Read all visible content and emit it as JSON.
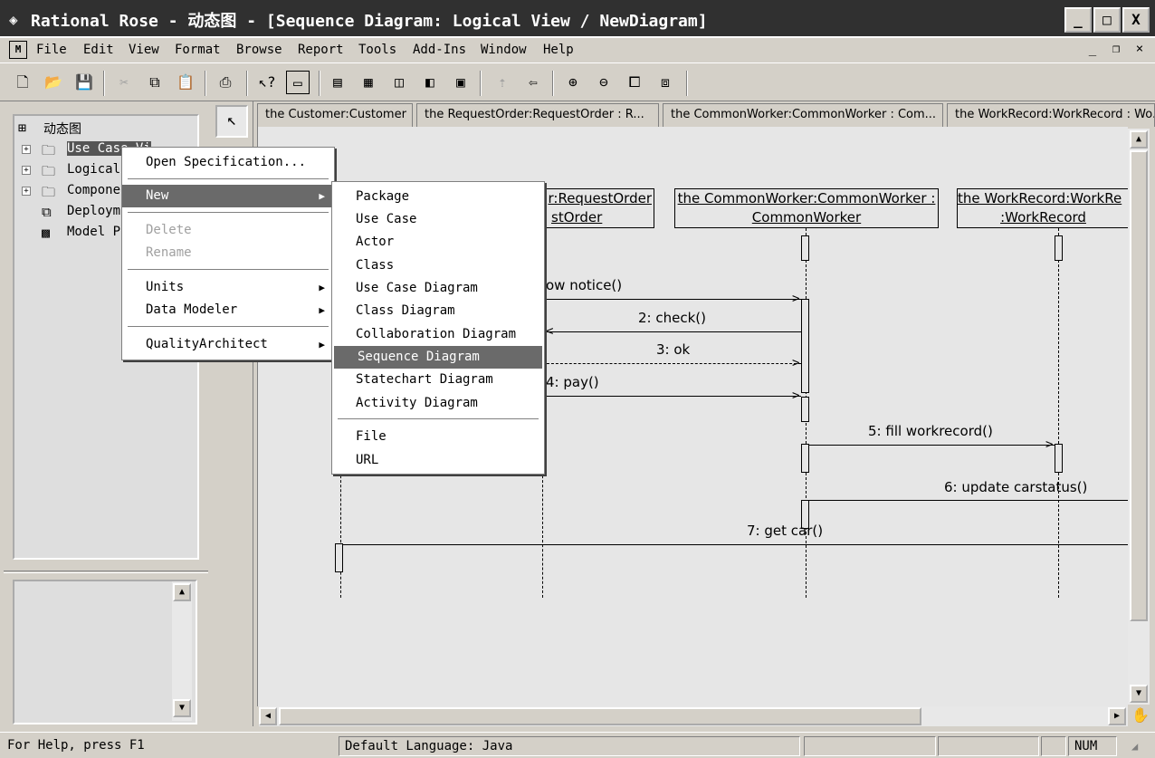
{
  "window": {
    "title": "Rational Rose - 动态图 - [Sequence Diagram: Logical View / NewDiagram]",
    "minimize": "_",
    "maximize": "□",
    "close": "X"
  },
  "menubar": {
    "items": [
      "File",
      "Edit",
      "View",
      "Format",
      "Browse",
      "Report",
      "Tools",
      "Add-Ins",
      "Window",
      "Help"
    ],
    "mdi_minimize": "_",
    "mdi_restore": "❐",
    "mdi_close": "×"
  },
  "toolbar": {
    "icons": [
      "new-icon",
      "open-icon",
      "save-icon",
      "cut-icon",
      "copy-icon",
      "paste-icon",
      "print-icon",
      "context-help-icon",
      "view-doc-icon",
      "browse-class-icon",
      "browse-interaction-icon",
      "browse-component-icon",
      "browse-deployment-icon",
      "browse-parent-icon",
      "browse-previous-icon",
      "zoom-in-icon",
      "zoom-out-icon",
      "fit-window-icon",
      "undo-fit-icon"
    ]
  },
  "browser": {
    "root": "动态图",
    "items": [
      {
        "label": "Use Case Vi",
        "expander": "+"
      },
      {
        "label": "Logical",
        "expander": "+"
      },
      {
        "label": "Compone",
        "expander": "+"
      },
      {
        "label": "Deploym",
        "expander": ""
      },
      {
        "label": "Model P",
        "expander": ""
      }
    ]
  },
  "tabs": [
    "the Customer:Customer",
    "the RequestOrder:RequestOrder : R...",
    "the CommonWorker:CommonWorker : Com...",
    "the WorkRecord:WorkRecord : Wo..."
  ],
  "diagram": {
    "objects": [
      {
        "line1": "r:RequestOrder",
        "line2": "stOrder"
      },
      {
        "line1": "the CommonWorker:CommonWorker :",
        "line2": "CommonWorker"
      },
      {
        "line1": "the WorkRecord:WorkRe",
        "line2": ":WorkRecord"
      }
    ],
    "messages": [
      "ow notice()",
      "2: check()",
      "3: ok",
      "4: pay()",
      "5: fill workrecord()",
      "6: update carstatus()",
      "7: get car()"
    ]
  },
  "context_menu": {
    "items": [
      {
        "label": "Open Specification...",
        "enabled": true
      },
      {
        "label": "New",
        "enabled": true,
        "submenu": true
      },
      {
        "label": "Delete",
        "enabled": false
      },
      {
        "label": "Rename",
        "enabled": false
      },
      {
        "label": "Units",
        "enabled": true,
        "submenu": true
      },
      {
        "label": "Data Modeler",
        "enabled": true,
        "submenu": true
      },
      {
        "label": "QualityArchitect",
        "enabled": true,
        "submenu": true
      }
    ]
  },
  "submenu_new": {
    "items": [
      "Package",
      "Use Case",
      "Actor",
      "Class",
      "Use Case Diagram",
      "Class Diagram",
      "Collaboration Diagram",
      "Sequence Diagram",
      "Statechart Diagram",
      "Activity Diagram",
      "File",
      "URL"
    ],
    "highlighted": "Sequence Diagram"
  },
  "statusbar": {
    "help": "For Help, press F1",
    "language": "Default Language: Java",
    "num": "NUM"
  }
}
